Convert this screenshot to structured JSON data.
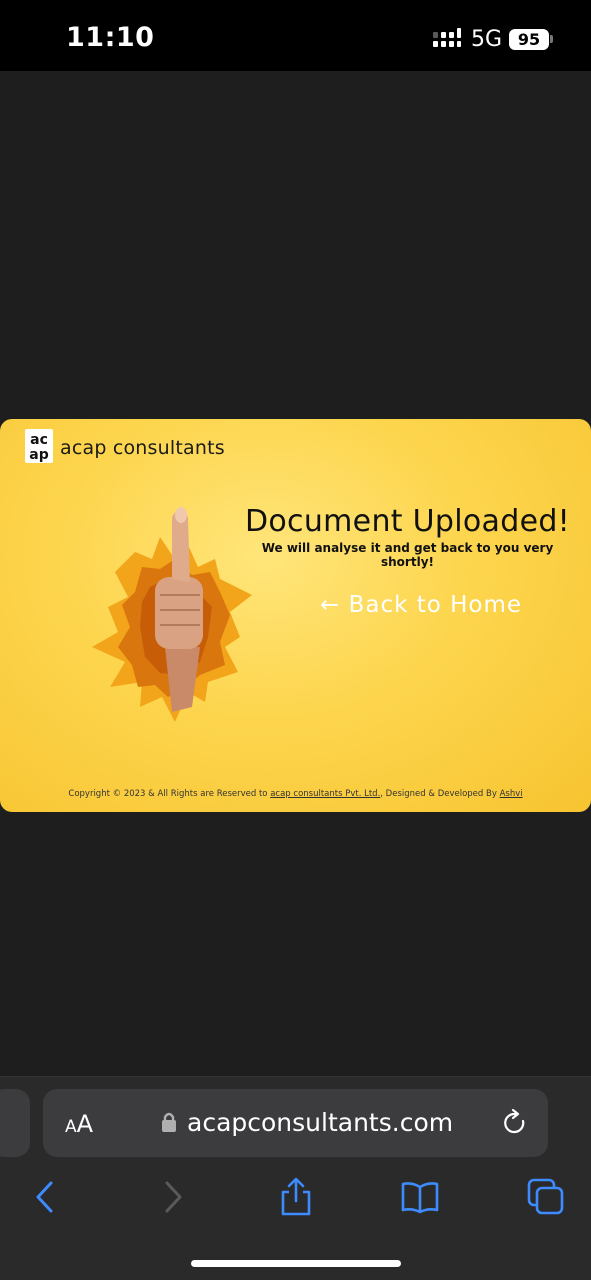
{
  "status_bar": {
    "time": "11:10",
    "network": "5G",
    "battery": "95",
    "icons": [
      "signal-icon",
      "battery-icon"
    ]
  },
  "page": {
    "logo": {
      "mark": "ac ap",
      "name": "acap consultants"
    },
    "title": "Document Uploaded!",
    "subtitle": "We will analyse it and get back to you very shortly!",
    "back_link": "← Back to Home",
    "footer": {
      "prefix": "Copyright © 2023 & All Rights are Reserved to ",
      "company_link": "acap consultants Pvt. Ltd.",
      "middle": ", Designed & Developed By ",
      "developer_link": "Ashvi"
    },
    "colors": {
      "accent": "#fdd54d",
      "text": "#111111"
    }
  },
  "browser": {
    "text_size_label": "AA",
    "url": "acapconsultants.com",
    "icons": [
      "lock-icon",
      "reload-icon",
      "back-icon",
      "forward-icon",
      "share-icon",
      "bookmarks-icon",
      "tabs-icon"
    ]
  }
}
